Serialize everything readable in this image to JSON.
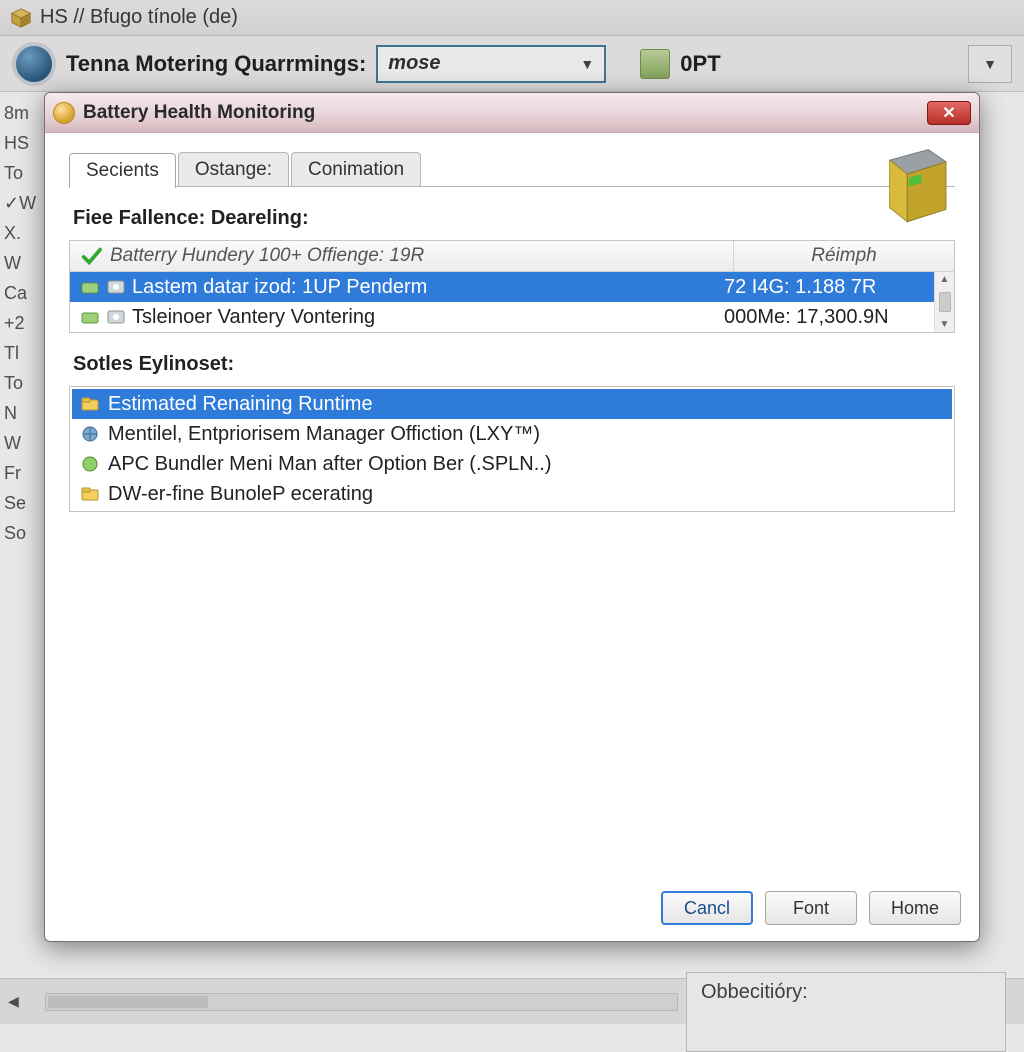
{
  "bg": {
    "title": "HS // Bfugo tínole (de)",
    "toolbar_label": "Tenna Motering Quarrmings:",
    "select_value": "mose",
    "opt_label": "0PT",
    "left_items": [
      "8m",
      "HS",
      "To",
      "✓W",
      "X.",
      "W",
      "Ca",
      "+2",
      "Tl",
      "To",
      "N",
      "W",
      "Fr",
      "Se",
      "So"
    ],
    "footer_label": "Obbecitióry:"
  },
  "dialog": {
    "title": "Battery Health Monitoring",
    "tabs": [
      "Secients",
      "Ostange:",
      "Conimation"
    ],
    "section1_label": "Fiee Fallence: Deareling:",
    "table": {
      "header_main": "Batterry Hundery 100+ Offienge: 19R",
      "header_right": "Réimph",
      "rows": [
        {
          "main": "Lastem datar izod:  1UP  Penderm",
          "right": "72 I4G:  1.188  7R",
          "selected": true
        },
        {
          "main": "Tsleinoer Vantery Vontering",
          "right": "000Me: 17,300.9N",
          "selected": false
        }
      ]
    },
    "section2_label": "Sotles Eylinoset:",
    "list2": [
      {
        "label": "Estimated  Renaining Runtime",
        "selected": true,
        "icon": "folder"
      },
      {
        "label": "Mentilel, Entpriorisem Manager Offiction (LXY™)",
        "selected": false,
        "icon": "globe"
      },
      {
        "label": "APC Bundler Meni Man after Option Ber (.SPLN..)",
        "selected": false,
        "icon": "green"
      },
      {
        "label": "DW-er-fine BunoleP ecerating",
        "selected": false,
        "icon": "folder"
      }
    ],
    "buttons": {
      "cancel": "Cancl",
      "font": "Font",
      "home": "Home"
    }
  }
}
